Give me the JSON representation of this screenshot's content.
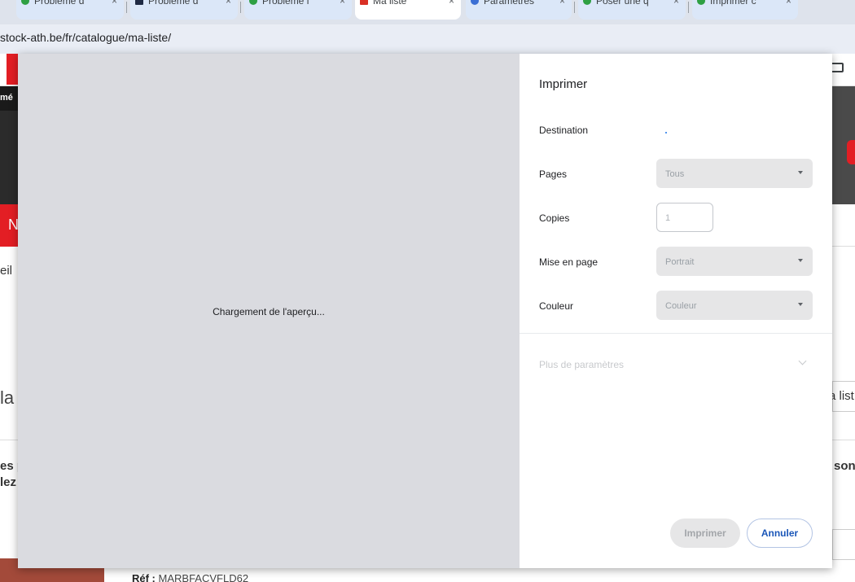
{
  "browser": {
    "tabs": [
      {
        "label": "Problème d",
        "close": "×"
      },
      {
        "label": "Problème d",
        "close": "×"
      },
      {
        "label": "Problème l",
        "close": "×"
      },
      {
        "label": "Ma liste",
        "close": "×"
      },
      {
        "label": "Paramètres",
        "close": "×"
      },
      {
        "label": "Poser une q",
        "close": "×"
      },
      {
        "label": "Imprimer c",
        "close": "×"
      }
    ],
    "url": "stock-ath.be/fr/catalogue/ma-liste/"
  },
  "site": {
    "top_left_text": "mé",
    "nav_letter": "N",
    "breadcrumb_fragment": "eil",
    "title_fragment": "la",
    "text_fragment_1": "es p",
    "text_fragment_2": "lez",
    "right_fragment_list": "a list",
    "right_fragment_son": "son",
    "ref_label": "Réf :",
    "ref_value": "MARBFACVFLD62"
  },
  "print_dialog": {
    "title": "Imprimer",
    "preview_loading": "Chargement de l'aperçu...",
    "destination_label": "Destination",
    "pages_label": "Pages",
    "pages_value": "Tous",
    "copies_label": "Copies",
    "copies_value": "1",
    "layout_label": "Mise en page",
    "layout_value": "Portrait",
    "color_label": "Couleur",
    "color_value": "Couleur",
    "more_settings": "Plus de paramètres",
    "print_button": "Imprimer",
    "cancel_button": "Annuler"
  },
  "colors": {
    "preview_bg": "#dadbe0",
    "accent_blue": "#1a56b8",
    "site_red": "#e31e24"
  }
}
